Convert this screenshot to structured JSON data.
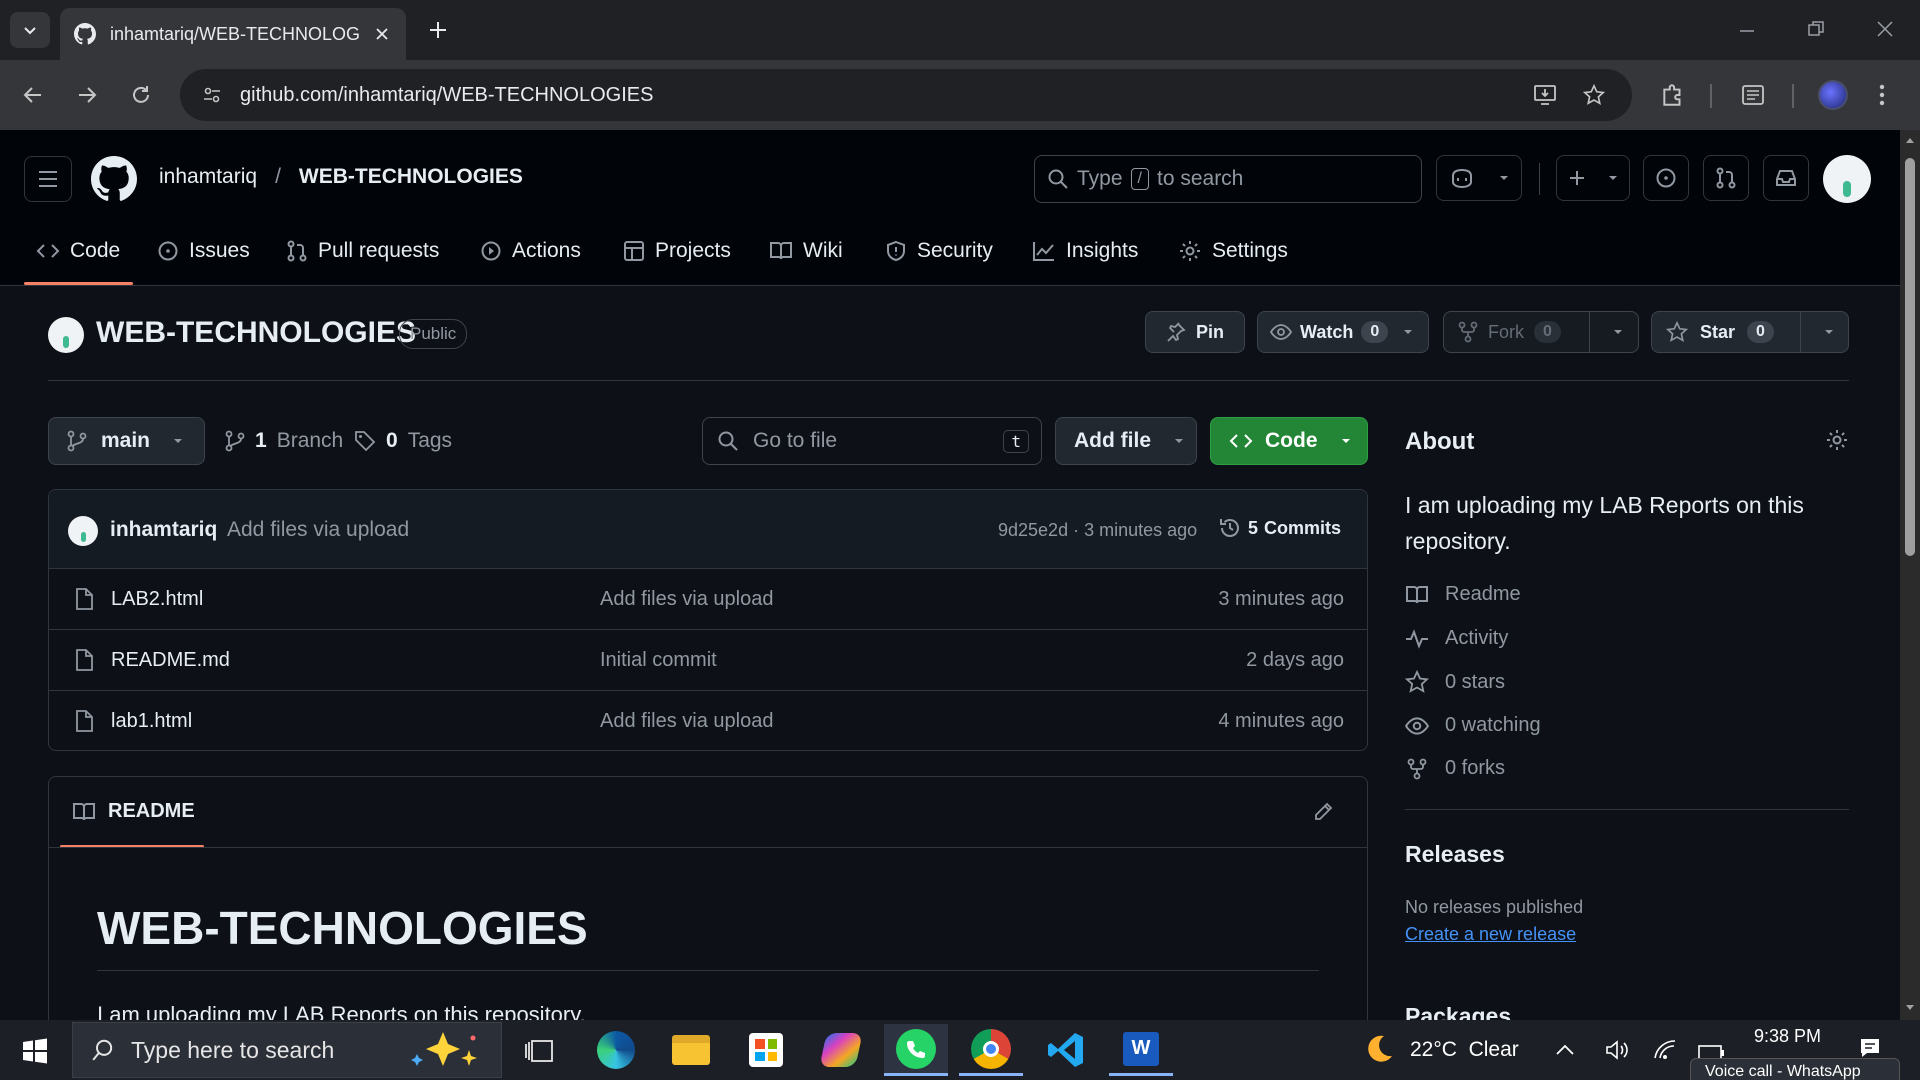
{
  "browser": {
    "tab_title": "inhamtariq/WEB-TECHNOLOGIES",
    "url": "github.com/inhamtariq/WEB-TECHNOLOGIES"
  },
  "header": {
    "owner": "inhamtariq",
    "separator": "/",
    "repo": "WEB-TECHNOLOGIES",
    "search_prefix": "Type",
    "search_key": "/",
    "search_suffix": "to search"
  },
  "nav": {
    "code": "Code",
    "issues": "Issues",
    "pulls": "Pull requests",
    "actions": "Actions",
    "projects": "Projects",
    "wiki": "Wiki",
    "security": "Security",
    "insights": "Insights",
    "settings": "Settings"
  },
  "repo": {
    "name": "WEB-TECHNOLOGIES",
    "visibility": "Public",
    "pin": "Pin",
    "watch": "Watch",
    "watch_count": "0",
    "fork": "Fork",
    "fork_count": "0",
    "star": "Star",
    "star_count": "0"
  },
  "branchbar": {
    "branch": "main",
    "branches_count": "1",
    "branches_label": "Branch",
    "tags_count": "0",
    "tags_label": "Tags",
    "goto_placeholder": "Go to file",
    "goto_key": "t",
    "add_file": "Add file",
    "code": "Code"
  },
  "commit": {
    "author": "inhamtariq",
    "message": "Add files via upload",
    "hash_time": "9d25e2d · 3 minutes ago",
    "commits_count": "5",
    "commits_label": "Commits"
  },
  "files": [
    {
      "name": "LAB2.html",
      "message": "Add files via upload",
      "time": "3 minutes ago"
    },
    {
      "name": "README.md",
      "message": "Initial commit",
      "time": "2 days ago"
    },
    {
      "name": "lab1.html",
      "message": "Add files via upload",
      "time": "4 minutes ago"
    }
  ],
  "readme": {
    "tab": "README",
    "heading": "WEB-TECHNOLOGIES",
    "body": "I am uploading my LAB Reports on this repository."
  },
  "about": {
    "title": "About",
    "description": "I am uploading my LAB Reports on this repository.",
    "readme": "Readme",
    "activity": "Activity",
    "stars": "0 stars",
    "watching": "0 watching",
    "forks": "0 forks",
    "releases_title": "Releases",
    "no_releases": "No releases published",
    "create_release": "Create a new release",
    "packages_title": "Packages"
  },
  "taskbar": {
    "search_placeholder": "Type here to search",
    "weather": "22°C  Clear",
    "time": "9:38 PM",
    "notification": "Voice call - WhatsApp"
  },
  "colors": {
    "page_bg": "#0d1117",
    "header_bg": "#010409",
    "accent_green": "#238636",
    "active_underline": "#f78166",
    "link_blue": "#4493f8"
  }
}
